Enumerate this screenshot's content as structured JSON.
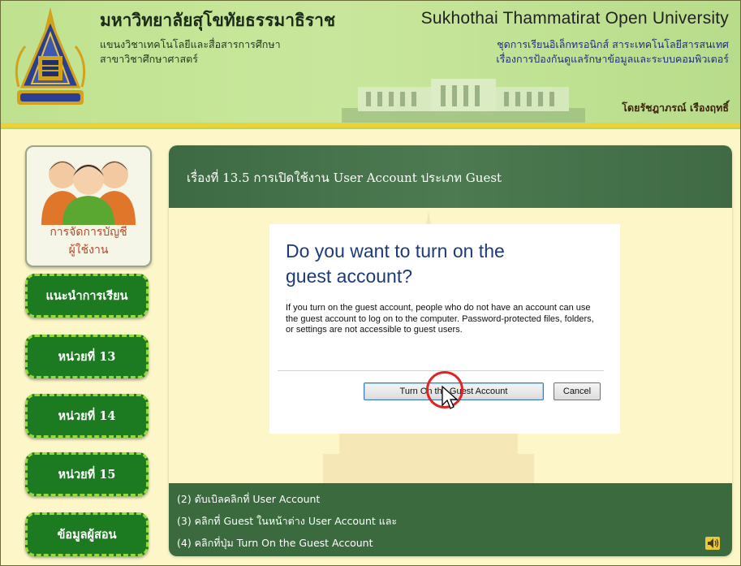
{
  "header": {
    "university_th": "มหาวิทยาลัยสุโขทัยธรรมาธิราช",
    "department_th": "แขนงวิชาเทคโนโลยีและสื่อสารการศึกษา",
    "school_th": "สาขาวิชาศึกษาศาสตร์",
    "university_en": "Sukhothai Thammatirat Open University",
    "series_line1": "ชุดการเรียนอิเล็กทรอนิกส์ สาระเทคโนโลยีสารสนเทศ",
    "series_line2": "เรื่องการป้องกันดูแลรักษาข้อมูลและระบบคอมพิวเตอร์",
    "author": "โดยรัชฎาภรณ์ เรืองฤทธิ์"
  },
  "sidebar": {
    "topic_line1": "การจัดการบัญชี",
    "topic_line2": "ผู้ใช้งาน",
    "buttons": [
      "แนะนำการเรียน",
      "หน่วยที่ 13",
      "หน่วยที่ 14",
      "หน่วยที่ 15",
      "ข้อมูลผู้สอน"
    ]
  },
  "lesson": {
    "title": "เรื่องที่ 13.5 การเปิดใช้งาน User Account ประเภท Guest",
    "dialog": {
      "heading_line1": "Do you want to turn on the",
      "heading_line2": "guest account?",
      "description": "If you turn on the guest account, people who do not have an account can use the guest account to log on to the computer. Password-protected files, folders, or settings are not accessible to guest users.",
      "primary_button": "Turn On the Guest Account",
      "cancel_button": "Cancel"
    },
    "steps": [
      "(2) ดับเบิลคลิกที่ User Account",
      "(3) คลิกที่ Guest ในหน้าต่าง User Account และ",
      "(4) คลิกที่ปุ่ม Turn On the Guest Account"
    ]
  },
  "colors": {
    "header_green": "#c4e497",
    "nav_green": "#1c7a20",
    "nav_border": "#97d83a",
    "panel_green": "#3d6a43",
    "background_cream": "#fdf6c8",
    "highlight_red": "#e02525"
  },
  "icons": [
    "university-crest-icon",
    "user-group-icon",
    "mouse-cursor-icon",
    "speaker-icon"
  ]
}
